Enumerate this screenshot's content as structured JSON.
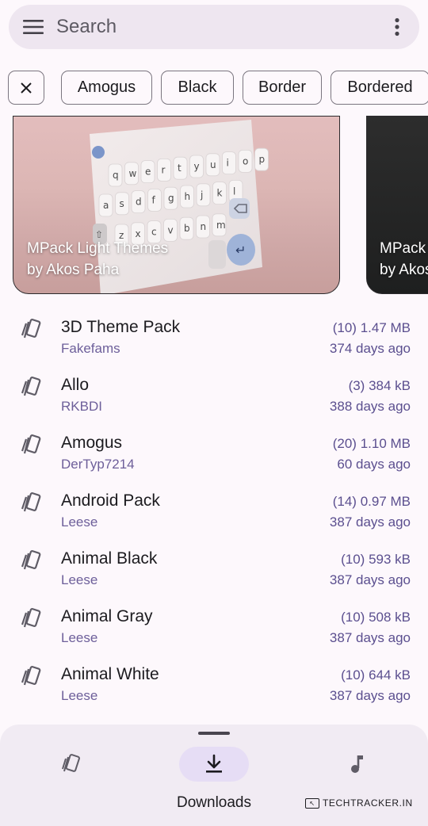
{
  "search": {
    "placeholder": "Search"
  },
  "chips": [
    "Amogus",
    "Black",
    "Border",
    "Bordered"
  ],
  "featured": [
    {
      "title": "MPack Light Themes",
      "author": "by Akos Paha"
    },
    {
      "title": "MPack",
      "author": "by Akos"
    }
  ],
  "keyboard": {
    "row1": [
      "q",
      "w",
      "e",
      "r",
      "t",
      "y",
      "u",
      "i",
      "o",
      "p"
    ],
    "row2": [
      "a",
      "s",
      "d",
      "f",
      "g",
      "h",
      "j",
      "k",
      "l"
    ],
    "row3": [
      "z",
      "x",
      "c",
      "v",
      "b",
      "n",
      "m"
    ]
  },
  "themes": [
    {
      "name": "3D Theme Pack",
      "author": "Fakefams",
      "size": "(10) 1.47 MB",
      "date": "374 days ago"
    },
    {
      "name": "Allo",
      "author": "RKBDI",
      "size": "(3) 384 kB",
      "date": "388 days ago"
    },
    {
      "name": "Amogus",
      "author": "DerTyp7214",
      "size": "(20) 1.10 MB",
      "date": "60 days ago"
    },
    {
      "name": "Android Pack",
      "author": "Leese",
      "size": "(14) 0.97 MB",
      "date": "387 days ago"
    },
    {
      "name": "Animal Black",
      "author": "Leese",
      "size": "(10) 593 kB",
      "date": "387 days ago"
    },
    {
      "name": "Animal Gray",
      "author": "Leese",
      "size": "(10) 508 kB",
      "date": "387 days ago"
    },
    {
      "name": "Animal White",
      "author": "Leese",
      "size": "(10) 644 kB",
      "date": "387 days ago"
    }
  ],
  "nav": {
    "themes_icon": "theme-cards-icon",
    "downloads_label": "Downloads",
    "music_icon": "music-note-icon"
  },
  "watermark": "TECHTRACKER.IN",
  "colors": {
    "accent": "#6d5f9a",
    "nav_active_pill": "#e6ddf5",
    "search_bg": "#eee6f0"
  }
}
